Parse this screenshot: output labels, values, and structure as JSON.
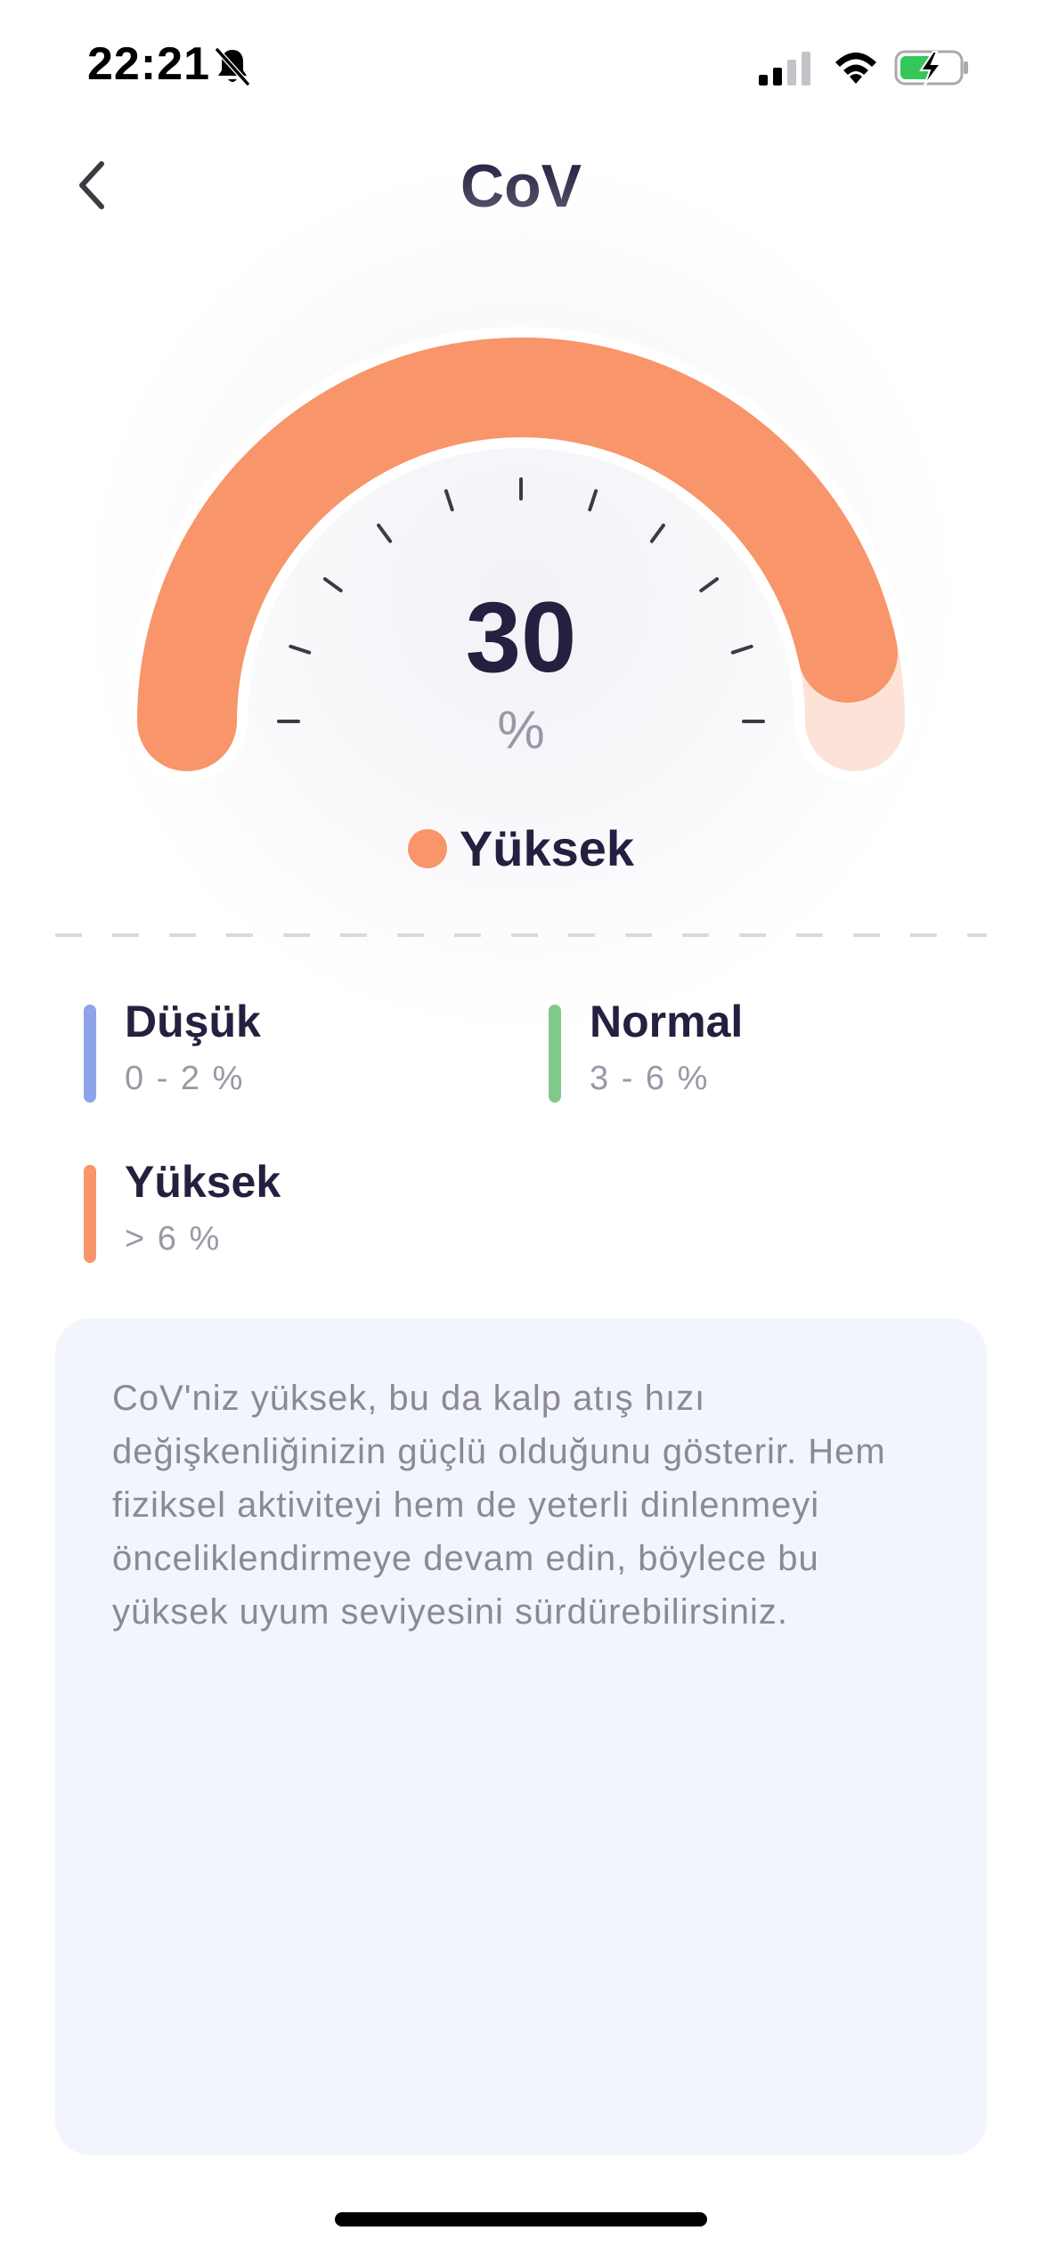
{
  "status_bar": {
    "time": "22:21"
  },
  "header": {
    "title": "CoV"
  },
  "gauge": {
    "value": "30",
    "unit": "%",
    "fill_fraction": 1.0,
    "status_label": "Yüksek",
    "status_color": "#f8956a"
  },
  "legend": {
    "items": [
      {
        "title": "Düşük",
        "range": "0 - 2 %",
        "color": "#8fa3ea"
      },
      {
        "title": "Normal",
        "range": "3 - 6 %",
        "color": "#80c98a"
      },
      {
        "title": "Yüksek",
        "range": "> 6 %",
        "color": "#f8956a"
      }
    ]
  },
  "description": {
    "text": "CoV'niz yüksek, bu da kalp atış hızı değişkenliğinizin güçlü olduğunu gösterir. Hem fiziksel aktiviteyi hem de yeterli dinlenmeyi önceliklendirmeye devam edin, böylece bu yüksek uyum seviyesini sürdürebilirsiniz."
  },
  "colors": {
    "accent": "#f8956a",
    "accent_light": "#fde3d7",
    "card_bg": "#f2f5fc",
    "title_text": "#24203f"
  },
  "icons": {
    "back": "chevron-left-icon",
    "bell": "bell-slash-icon",
    "signal": "cellular-signal-icon",
    "wifi": "wifi-icon",
    "battery": "battery-charging-icon"
  }
}
